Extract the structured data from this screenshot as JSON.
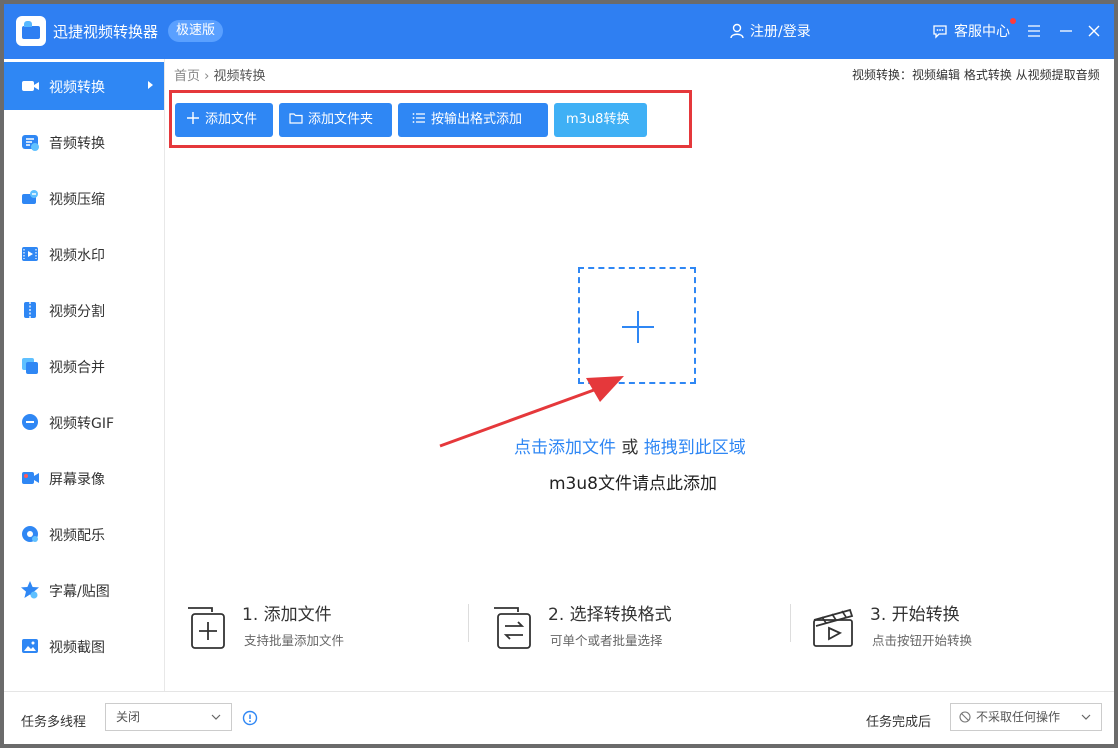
{
  "app": {
    "title": "迅捷视频转换器",
    "badge": "极速版"
  },
  "header": {
    "login": "注册/登录",
    "service": "客服中心"
  },
  "sidebar": {
    "items": [
      {
        "label": "视频转换",
        "icon": "video-camera-icon"
      },
      {
        "label": "音频转换",
        "icon": "audio-icon"
      },
      {
        "label": "视频压缩",
        "icon": "compress-icon"
      },
      {
        "label": "视频水印",
        "icon": "watermark-icon"
      },
      {
        "label": "视频分割",
        "icon": "split-icon"
      },
      {
        "label": "视频合并",
        "icon": "merge-icon"
      },
      {
        "label": "视频转GIF",
        "icon": "gif-icon"
      },
      {
        "label": "屏幕录像",
        "icon": "screen-record-icon"
      },
      {
        "label": "视频配乐",
        "icon": "music-icon"
      },
      {
        "label": "字幕/贴图",
        "icon": "sticker-icon"
      },
      {
        "label": "视频截图",
        "icon": "screenshot-icon"
      }
    ]
  },
  "breadcrumb": {
    "home": "首页",
    "sep": "›",
    "current": "视频转换"
  },
  "top_links": {
    "text": "视频转换：视频编辑 格式转换 从视频提取音频"
  },
  "toolbar": {
    "add_file": "添加文件",
    "add_folder": "添加文件夹",
    "add_by_format": "按输出格式添加",
    "m3u8": "m3u8转换"
  },
  "drop": {
    "click_add": "点击添加文件",
    "or": " 或 ",
    "drag": "拖拽到此区域",
    "m3u8_hint": "m3u8文件请点此添加"
  },
  "steps": [
    {
      "title": "1. 添加文件",
      "desc": "支持批量添加文件"
    },
    {
      "title": "2. 选择转换格式",
      "desc": "可单个或者批量选择"
    },
    {
      "title": "3. 开始转换",
      "desc": "点击按钮开始转换"
    }
  ],
  "footer": {
    "multithread_label": "任务多线程",
    "multithread_value": "关闭",
    "after_label": "任务完成后",
    "after_value": "不采取任何操作"
  },
  "colors": {
    "primary": "#2f87f4",
    "titlebar": "#2f7ff2",
    "highlight": "#e5383b"
  }
}
